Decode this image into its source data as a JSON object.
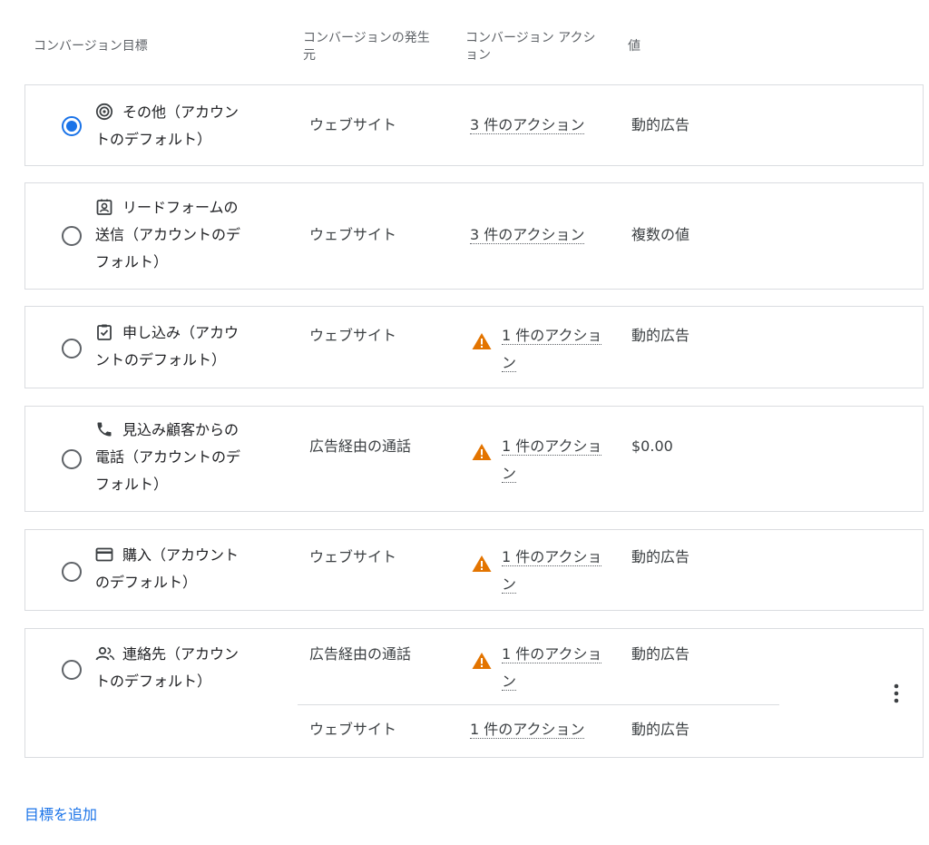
{
  "header": {
    "goal": "コンバージョン目標",
    "source_line1": "コンバージョンの発生",
    "source_line2": "元",
    "action_line1": "コンバージョン アクシ",
    "action_line2": "ョン",
    "value": "値"
  },
  "goals": [
    {
      "selected": true,
      "icon": "target-icon",
      "label_line1": "その他（アカウン",
      "label_line2": "トのデフォルト）",
      "rows": [
        {
          "source": "ウェブサイト",
          "action": "3 件のアクション",
          "warning": false,
          "value": "動的広告"
        }
      ]
    },
    {
      "selected": false,
      "icon": "contact-form-icon",
      "label_line1": "リードフォームの",
      "label_line2": "送信（アカウントのデ",
      "label_line3": "フォルト）",
      "rows": [
        {
          "source": "ウェブサイト",
          "action": "3 件のアクション",
          "warning": false,
          "value": "複数の値"
        }
      ]
    },
    {
      "selected": false,
      "icon": "checklist-icon",
      "label_line1": "申し込み（アカウ",
      "label_line2": "ントのデフォルト）",
      "rows": [
        {
          "source": "ウェブサイト",
          "action_line1": "1 件のアクショ",
          "action_line2": "ン",
          "warning": true,
          "value": "動的広告"
        }
      ]
    },
    {
      "selected": false,
      "icon": "phone-icon",
      "label_line1": "見込み顧客からの",
      "label_line2": "電話（アカウントのデ",
      "label_line3": "フォルト）",
      "rows": [
        {
          "source": "広告経由の通話",
          "action_line1": "1 件のアクショ",
          "action_line2": "ン",
          "warning": true,
          "value": "$0.00"
        }
      ]
    },
    {
      "selected": false,
      "icon": "credit-card-icon",
      "label_line1": "購入（アカウント",
      "label_line2": "のデフォルト）",
      "rows": [
        {
          "source": "ウェブサイト",
          "action_line1": "1 件のアクショ",
          "action_line2": "ン",
          "warning": true,
          "value": "動的広告"
        }
      ]
    },
    {
      "selected": false,
      "icon": "contacts-icon",
      "label_line1": "連絡先（アカウン",
      "label_line2": "トのデフォルト）",
      "rows": [
        {
          "source": "広告経由の通話",
          "action_line1": "1 件のアクショ",
          "action_line2": "ン",
          "warning": true,
          "value": "動的広告"
        },
        {
          "source": "ウェブサイト",
          "action": "1 件のアクション",
          "warning": false,
          "value": "動的広告"
        }
      ]
    }
  ],
  "add_goal_label": "目標を追加",
  "colors": {
    "accent": "#1a73e8",
    "warning": "#e37400",
    "border": "#dadce0"
  }
}
